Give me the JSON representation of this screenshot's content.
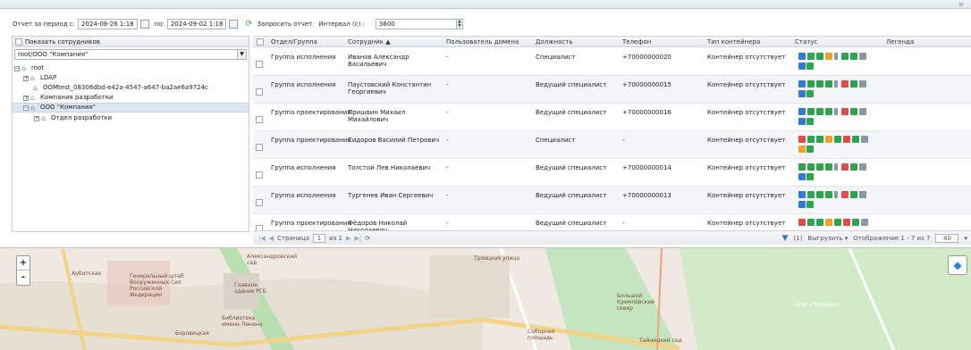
{
  "toolbar": {
    "period_from_label": "Отчет за период с:",
    "date_from": "2024-08-26 1:18",
    "period_to_label": "по:",
    "date_to": "2024-09-02 1:18",
    "request_label": "Запросить отчет",
    "interval_label": "Интервал (с) :",
    "interval_value": "3600"
  },
  "left_panel": {
    "show_employees_label": "Показать сотрудников",
    "org_path": "root/ООО \"Компания\"",
    "tree": [
      {
        "label": "root",
        "level": 0,
        "expander": "-"
      },
      {
        "label": "LDAP",
        "level": 1,
        "expander": "+"
      },
      {
        "label": "OOMtest_08306dbd-e42a-4547-a647-ba2ae6a9724c",
        "level": 1,
        "expander": ""
      },
      {
        "label": "Компания разработки",
        "level": 1,
        "expander": "+"
      },
      {
        "label": "ООО \"Компания\"",
        "level": 1,
        "expander": "-",
        "selected": true
      },
      {
        "label": "Отдел разработки",
        "level": 2,
        "expander": "+"
      }
    ]
  },
  "grid": {
    "columns": [
      "Отдел/Группа",
      "Сотрудник ▲",
      "Пользователь домена",
      "Должность",
      "Телефон",
      "Тип контейнера",
      "Статус",
      "Легенда"
    ],
    "rows": [
      {
        "group": "Группа исполнения",
        "employee": [
          "Иванов Александр",
          "Васильевич"
        ],
        "domain_user": "-",
        "position": "Специалист",
        "phone": "+70000000020",
        "container": "Контейнер отсутствует"
      },
      {
        "group": "Группа исполнения",
        "employee": [
          "Паустовский Константин",
          "Георгиевич"
        ],
        "domain_user": "-",
        "position": "Ведущий специалист",
        "phone": "+70000000015",
        "container": "Контейнер отсутствует"
      },
      {
        "group": "Группа проектирования",
        "employee": [
          "Пришвин Михаил",
          "Михайлович"
        ],
        "domain_user": "-",
        "position": "Ведущий специалист",
        "phone": "+70000000016",
        "container": "Контейнер отсутствует"
      },
      {
        "group": "Группа проектирования",
        "employee": [
          "Сидоров Василий Петрович",
          ""
        ],
        "domain_user": "-",
        "position": "Специалист",
        "phone": "-",
        "container": "Контейнер отсутствует"
      },
      {
        "group": "Группа исполнения",
        "employee": [
          "Толстой Лев Николаевич",
          ""
        ],
        "domain_user": "-",
        "position": "Ведущий специалист",
        "phone": "+70000000014",
        "container": "Контейнер отсутствует"
      },
      {
        "group": "Группа исполнения",
        "employee": [
          "Тургенев Иван Сергеевич",
          ""
        ],
        "domain_user": "-",
        "position": "Ведущий специалист",
        "phone": "+70000000013",
        "container": "Контейнер отсутствует"
      },
      {
        "group": "Группа проектирования",
        "employee": [
          "Фёдоров Николай",
          "Николаевич"
        ],
        "domain_user": "-",
        "position": "Ведущий специалист",
        "phone": "-",
        "container": "Контейнер отсутствует"
      }
    ]
  },
  "pager": {
    "page_label": "Страница",
    "page_value": "1",
    "of_label": "из 1",
    "filter_count": "(1)",
    "export_label": "Выгрузить",
    "display_label": "Отображение 1 - 7 из 7",
    "per_page": "40"
  },
  "map": {
    "labels": [
      "Генеральный штаб Вооруженных Сил Российской Федерации",
      "Арбатская",
      "Александровский сад",
      "Библиотека имени Ленина",
      "Боровицкая",
      "Троицкая улица",
      "Соборная площадь",
      "Большой Кремлёвский сквер",
      "Тайницкий сад",
      "парк «Зарядье»",
      "Главное здание РГБ"
    ]
  },
  "colors": {
    "status_blue": "#2f7bd6",
    "status_green": "#2ea44f",
    "status_orange": "#f0a02e",
    "status_red": "#e34b4b",
    "status_gray": "#8a97a5"
  }
}
